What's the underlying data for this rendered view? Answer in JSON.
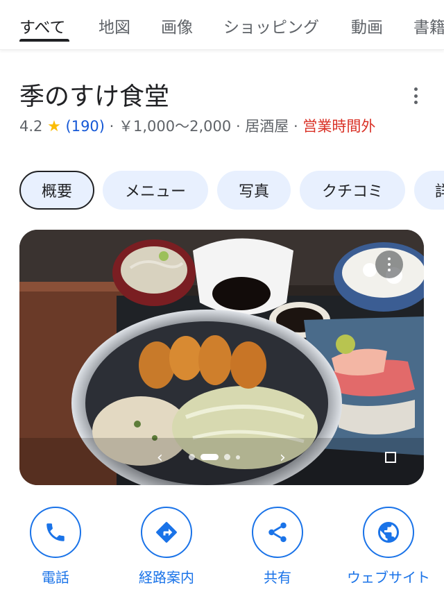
{
  "tabs": [
    "すべて",
    "地図",
    "画像",
    "ショッピング",
    "動画",
    "書籍"
  ],
  "place": {
    "name": "季のすけ食堂",
    "rating": "4.2",
    "reviews": "(190)",
    "price": "￥1,000〜2,000",
    "category": "居酒屋",
    "status": "営業時間外",
    "sep": " · "
  },
  "chips": [
    "概要",
    "メニュー",
    "写真",
    "クチコミ",
    "詳細"
  ],
  "gallery": {
    "active_index": 1,
    "count": 4
  },
  "actions": [
    {
      "label": "電話",
      "icon": "phone-icon"
    },
    {
      "label": "経路案内",
      "icon": "directions-icon"
    },
    {
      "label": "共有",
      "icon": "share-icon"
    },
    {
      "label": "ウェブサイト",
      "icon": "globe-icon"
    }
  ],
  "colors": {
    "accent": "#1a73e8",
    "closed": "#d93025",
    "chip_bg": "#e8f0fe",
    "star": "#fbbc04"
  }
}
